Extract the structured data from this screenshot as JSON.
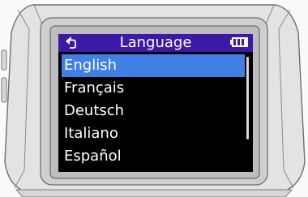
{
  "screen": {
    "title": "Language",
    "back_icon": "back-arrow-icon",
    "battery_icon": "battery-icon",
    "colors": {
      "header": "#3a1aa6",
      "selected": "#3f7fe6",
      "screen_bg": "#000000",
      "text": "#ffffff"
    }
  },
  "languages": [
    {
      "label": "English",
      "selected": true
    },
    {
      "label": "Français",
      "selected": false
    },
    {
      "label": "Deutsch",
      "selected": false
    },
    {
      "label": "Italiano",
      "selected": false
    },
    {
      "label": "Español",
      "selected": false
    }
  ]
}
